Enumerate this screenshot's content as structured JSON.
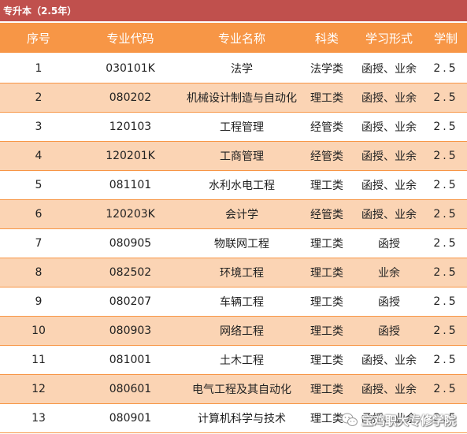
{
  "title": "专升本（2.5年）",
  "headers": [
    "序号",
    "专业代码",
    "专业名称",
    "科类",
    "学习形式",
    "学制"
  ],
  "rows": [
    {
      "no": "1",
      "code": "030101K",
      "name": "法学",
      "category": "法学类",
      "mode": "函授、业余",
      "duration": "2.5"
    },
    {
      "no": "2",
      "code": "080202",
      "name": "机械设计制造与自动化",
      "category": "理工类",
      "mode": "函授、业余",
      "duration": "2.5"
    },
    {
      "no": "3",
      "code": "120103",
      "name": "工程管理",
      "category": "经管类",
      "mode": "函授、业余",
      "duration": "2.5"
    },
    {
      "no": "4",
      "code": "120201K",
      "name": "工商管理",
      "category": "经管类",
      "mode": "函授、业余",
      "duration": "2.5"
    },
    {
      "no": "5",
      "code": "081101",
      "name": "水利水电工程",
      "category": "理工类",
      "mode": "函授、业余",
      "duration": "2.5"
    },
    {
      "no": "6",
      "code": "120203K",
      "name": "会计学",
      "category": "经管类",
      "mode": "函授、业余",
      "duration": "2.5"
    },
    {
      "no": "7",
      "code": "080905",
      "name": "物联网工程",
      "category": "理工类",
      "mode": "函授",
      "duration": "2.5"
    },
    {
      "no": "8",
      "code": "082502",
      "name": "环境工程",
      "category": "理工类",
      "mode": "业余",
      "duration": "2.5"
    },
    {
      "no": "9",
      "code": "080207",
      "name": "车辆工程",
      "category": "理工类",
      "mode": "函授",
      "duration": "2.5"
    },
    {
      "no": "10",
      "code": "080903",
      "name": "网络工程",
      "category": "理工类",
      "mode": "函授",
      "duration": "2.5"
    },
    {
      "no": "11",
      "code": "081001",
      "name": "土木工程",
      "category": "理工类",
      "mode": "函授、业余",
      "duration": "2.5"
    },
    {
      "no": "12",
      "code": "080601",
      "name": "电气工程及其自动化",
      "category": "理工类",
      "mode": "函授、业余",
      "duration": "2.5"
    },
    {
      "no": "13",
      "code": "080901",
      "name": "计算机科学与技术",
      "category": "理工类",
      "mode": "函授、业余",
      "duration": "2.5"
    }
  ],
  "watermark": {
    "text": "宝鸡职大专修学院",
    "icon": "wechat-icon"
  },
  "colors": {
    "title_bg": "#c0504d",
    "header_bg": "#f79646",
    "alt_row_bg": "#fbd4b4",
    "text": "#222222"
  }
}
